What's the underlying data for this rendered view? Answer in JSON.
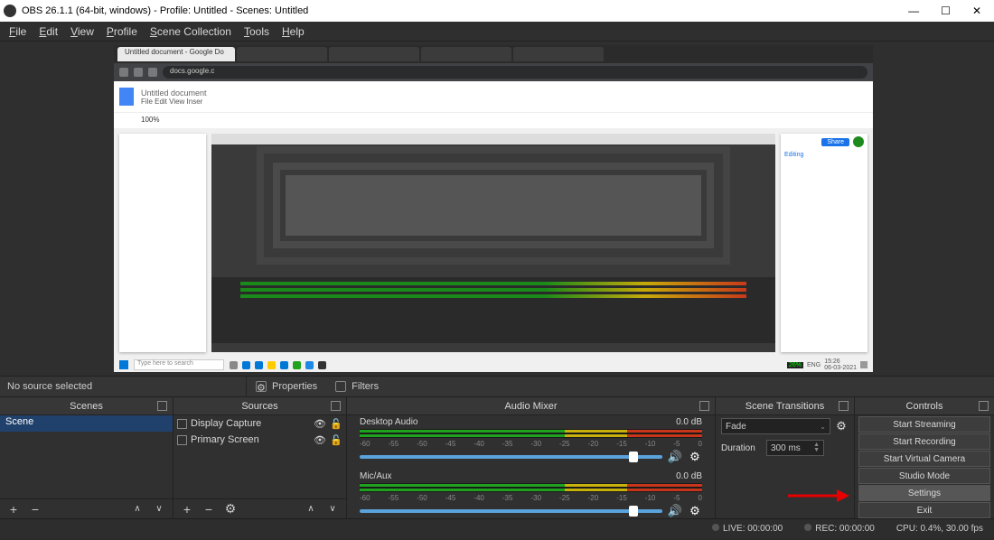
{
  "titlebar": {
    "title": "OBS 26.1.1 (64-bit, windows) - Profile: Untitled - Scenes: Untitled"
  },
  "menu": {
    "file": "File",
    "edit": "Edit",
    "view": "View",
    "profile": "Profile",
    "scene_collection": "Scene Collection",
    "tools": "Tools",
    "help": "Help"
  },
  "preview": {
    "browser_tab_1": "Untitled document - Google Do",
    "browser_url": "docs.google.c",
    "docs_title": "Untitled document",
    "docs_menu": "File   Edit   View   Inser",
    "docs_zoom": "100%",
    "taskbar_search": "Type here to search",
    "tray_batt": "26%",
    "tray_lang": "ENG",
    "tray_time": "15:26",
    "tray_date": "06-03-2021",
    "right_share": "Share",
    "right_editing": "Editing"
  },
  "midbar": {
    "no_source": "No source selected",
    "properties": "Properties",
    "filters": "Filters"
  },
  "scenes": {
    "title": "Scenes",
    "items": [
      {
        "label": "Scene"
      }
    ]
  },
  "sources": {
    "title": "Sources",
    "items": [
      {
        "label": "Display Capture"
      },
      {
        "label": "Primary Screen"
      }
    ]
  },
  "mixer": {
    "title": "Audio Mixer",
    "tracks": [
      {
        "name": "Desktop Audio",
        "db": "0.0 dB"
      },
      {
        "name": "Mic/Aux",
        "db": "0.0 dB"
      }
    ],
    "scale": [
      "-60",
      "-55",
      "-50",
      "-45",
      "-40",
      "-35",
      "-30",
      "-25",
      "-20",
      "-15",
      "-10",
      "-5",
      "0"
    ]
  },
  "transitions": {
    "title": "Scene Transitions",
    "mode": "Fade",
    "duration_label": "Duration",
    "duration_value": "300 ms"
  },
  "controls": {
    "title": "Controls",
    "buttons": {
      "stream": "Start Streaming",
      "record": "Start Recording",
      "vcam": "Start Virtual Camera",
      "studio": "Studio Mode",
      "settings": "Settings",
      "exit": "Exit"
    }
  },
  "statusbar": {
    "live": "LIVE: 00:00:00",
    "rec": "REC: 00:00:00",
    "cpu": "CPU: 0.4%, 30.00 fps"
  }
}
